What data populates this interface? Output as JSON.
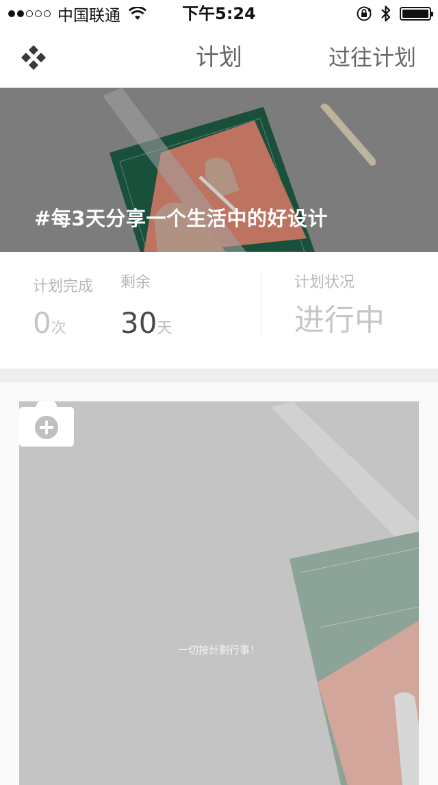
{
  "status_bar": {
    "signal_dots": [
      true,
      true,
      false,
      false,
      false
    ],
    "carrier": "中国联通",
    "time": "下午5:24",
    "icons": [
      "wifi-icon",
      "orientation-lock-icon",
      "bluetooth-icon",
      "battery-icon"
    ]
  },
  "nav": {
    "logo_icon": "diamond-logo-icon",
    "title": "计划",
    "past_plans": "过往计划"
  },
  "banner": {
    "caption": "#每3天分享一个生活中的好设计"
  },
  "stats": {
    "completed": {
      "label": "计划完成",
      "value": "0",
      "unit": "次"
    },
    "remaining": {
      "label": "剩余",
      "value": "30",
      "unit": "天"
    },
    "status": {
      "label": "计划状况",
      "value": "进行中"
    }
  },
  "card": {
    "camera_icon": "camera-add-icon",
    "hint": "一切按計劃行事！"
  },
  "colors": {
    "nav_text": "#666666",
    "muted": "#c5c5c5",
    "dark_value": "#4a4a4a",
    "banner_text": "#ffffff",
    "cutting_mat": "#1f6b4f",
    "paper": "#ef8f7a"
  }
}
